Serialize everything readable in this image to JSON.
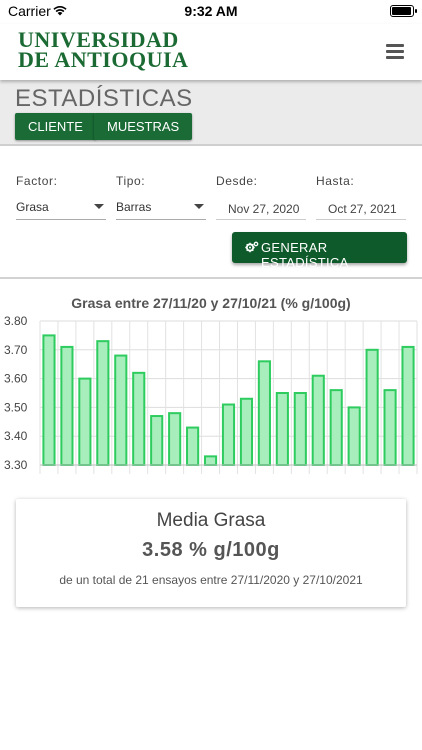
{
  "status_bar": {
    "carrier": "Carrier",
    "time": "9:32 AM"
  },
  "header": {
    "logo_line1": "UNIVERSIDAD",
    "logo_line2": "DE ANTIOQUIA",
    "menu_icon": "hamburger-icon"
  },
  "section": {
    "title": "ESTADÍSTICAS",
    "tabs": [
      {
        "label": "CLIENTE"
      },
      {
        "label": "MUESTRAS"
      }
    ]
  },
  "filters": {
    "factor": {
      "label": "Factor:",
      "value": "Grasa"
    },
    "tipo": {
      "label": "Tipo:",
      "value": "Barras"
    },
    "desde": {
      "label": "Desde:",
      "value": "Nov 27, 2020"
    },
    "hasta": {
      "label": "Hasta:",
      "value": "Oct 27, 2021"
    },
    "generate_label": "GENERAR ESTADÍSTICA",
    "generate_icon": "gears-icon"
  },
  "chart_data": {
    "type": "bar",
    "title": "Grasa entre 27/11/20 y 27/10/21 (% g/100g)",
    "xlabel": "",
    "ylabel": "",
    "ylim": [
      3.3,
      3.8
    ],
    "yticks": [
      "3.80",
      "3.70",
      "3.60",
      "3.50",
      "3.40",
      "3.30"
    ],
    "categories": [
      "",
      "",
      "",
      "",
      "",
      "",
      "",
      "",
      "",
      "",
      "",
      "",
      "",
      "",
      "",
      "",
      "",
      "",
      "",
      "",
      ""
    ],
    "values": [
      3.75,
      3.71,
      3.6,
      3.73,
      3.68,
      3.62,
      3.47,
      3.48,
      3.43,
      3.33,
      3.51,
      3.53,
      3.66,
      3.55,
      3.55,
      3.61,
      3.56,
      3.5,
      3.7,
      3.56,
      3.71
    ],
    "grid": true,
    "colors": {
      "fill": "#a8edbc",
      "stroke": "#2ecc5f"
    }
  },
  "summary": {
    "title": "Media Grasa",
    "value": "3.58 % g/100g",
    "note": "de un total de 21 ensayos entre 27/11/2020 y 27/10/2021"
  }
}
